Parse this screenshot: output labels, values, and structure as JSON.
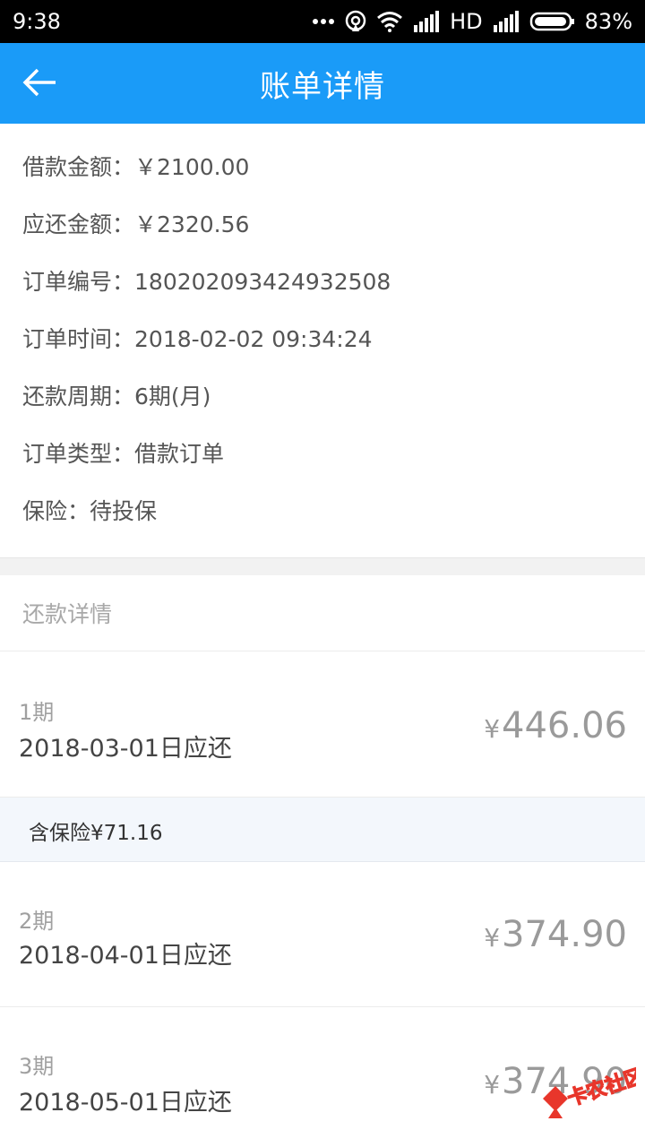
{
  "status_bar": {
    "time": "9:38",
    "network": "HD",
    "battery": "83%"
  },
  "app_bar": {
    "title": "账单详情"
  },
  "order": {
    "loan_amount": {
      "label": "借款金额：",
      "value": "￥2100.00"
    },
    "repay_amount": {
      "label": "应还金额：",
      "value": "￥2320.56"
    },
    "order_no": {
      "label": "订单编号：",
      "value": "180202093424932508"
    },
    "order_time": {
      "label": "订单时间：",
      "value": "2018-02-02 09:34:24"
    },
    "period": {
      "label": "还款周期：",
      "value": "6期(月)"
    },
    "order_type": {
      "label": "订单类型：",
      "value": "借款订单"
    },
    "insurance": {
      "label": "保险：",
      "value": "待投保"
    }
  },
  "repayment": {
    "header": "还款详情",
    "installments": [
      {
        "period": "1期",
        "date": "2018-03-01日应还",
        "currency": "¥",
        "amount": "446.06"
      },
      {
        "period": "2期",
        "date": "2018-04-01日应还",
        "currency": "¥",
        "amount": "374.90"
      },
      {
        "period": "3期",
        "date": "2018-05-01日应还",
        "currency": "¥",
        "amount": "374.90"
      }
    ],
    "insurance_note": "含保险¥71.16"
  },
  "watermark": {
    "text": "卡农社区"
  },
  "colors": {
    "app_bar": "#1a9bf8",
    "status_bar": "#000000",
    "insurance_bar": "#f3f7fc"
  }
}
